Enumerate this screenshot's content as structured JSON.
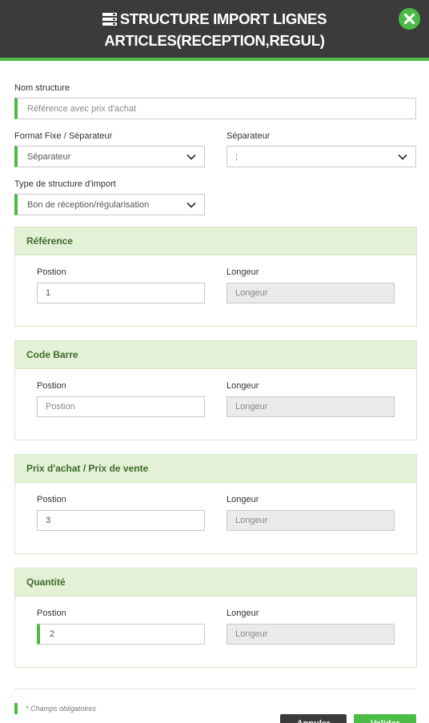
{
  "header": {
    "title_line1": "STRUCTURE IMPORT LIGNES",
    "title_line2": "ARTICLES(RECEPTION,REGUL)",
    "title_icon": "list-icon",
    "close_icon": "close-icon",
    "accent_color": "#4cbb46",
    "header_bg": "#3b3b3b"
  },
  "form": {
    "nom_structure": {
      "label": "Nom structure",
      "placeholder": "Référence avec prix d'achat"
    },
    "format": {
      "label": "Format Fixe / Séparateur",
      "selected": "Séparateur"
    },
    "separateur": {
      "label": "Séparateur",
      "selected": ";"
    },
    "type_structure": {
      "label": "Type de structure d'import",
      "selected": "Bon de réception/régularisation"
    }
  },
  "sections": [
    {
      "title": "Référence",
      "position_label": "Postion",
      "position_value": "1",
      "position_placeholder": "",
      "longueur_label": "Longeur",
      "longueur_placeholder": "Longeur"
    },
    {
      "title": "Code Barre",
      "position_label": "Postion",
      "position_value": "",
      "position_placeholder": "Postion",
      "longueur_label": "Longeur",
      "longueur_placeholder": "Longeur"
    },
    {
      "title": "Prix d'achat / Prix de vente",
      "position_label": "Postion",
      "position_value": "3",
      "position_placeholder": "",
      "longueur_label": "Longeur",
      "longueur_placeholder": "Longeur"
    },
    {
      "title": "Quantité",
      "position_label": "Postion",
      "position_value": "2",
      "position_placeholder": "",
      "longueur_label": "Longeur",
      "longueur_placeholder": "Longeur"
    }
  ],
  "footer": {
    "required_note": "* Champs obligatoires",
    "cancel_label": "Annuler",
    "save_label": "Valider"
  }
}
